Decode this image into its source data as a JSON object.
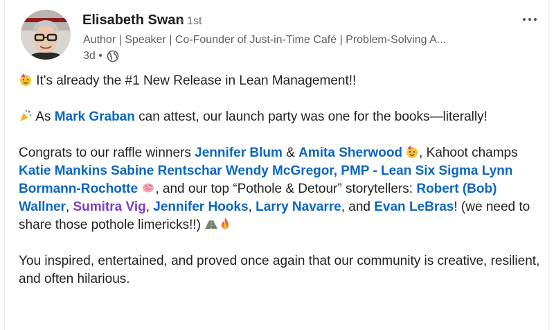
{
  "author": {
    "name": "Elisabeth Swan",
    "degree": "• 1st",
    "headline": "Author | Speaker | Co-Founder of Just-in-Time Café | Problem-Solving A...",
    "time": "3d •"
  },
  "icons": {
    "avatar": "author-photo",
    "visibility": "globe-icon",
    "menu": "more-options-icon"
  },
  "post": {
    "line1": "It's already the #1 New Release in Lean Management!!",
    "line2_pre": "As",
    "line2_mention": "Mark Graban",
    "line2_post": "can attest, our launch party was one for the books—literally!",
    "p3": {
      "t1": "Congrats to our raffle winners",
      "m1": "Jennifer Blum",
      "t2": "&",
      "m2": "Amita Sherwood",
      "t3": ", Kahoot champs",
      "m3": "Katie Mankins",
      "m4": "Sabine Rentschar",
      "m5": "Wendy McGregor, PMP - Lean Six Sigma",
      "m6": "Lynn Bormann-Rochotte",
      "t4": ", and our top “Pothole & Detour” storytellers:",
      "m7": "Robert (Bob) Wallner",
      "t5": ",",
      "m8": "Sumitra Vig",
      "t6": ",",
      "m9": "Jennifer Hooks",
      "t7": ",",
      "m10": "Larry Navarre",
      "t8": ", and",
      "m11": "Evan LeBras",
      "t9": "! (we need to share those pothole limericks!!)"
    },
    "p4": "You inspired, entertained, and proved once again that our community is creative, resilient, and often hilarious."
  }
}
